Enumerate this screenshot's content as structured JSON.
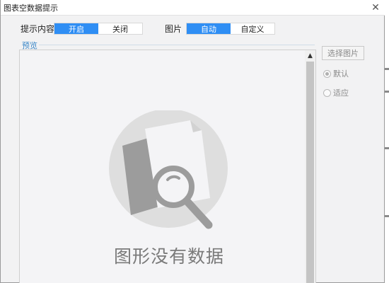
{
  "window": {
    "title": "图表空数据提示",
    "close_glyph": "✕"
  },
  "content_setting": {
    "label": "提示内容",
    "options": [
      "开启",
      "关闭"
    ],
    "selected": "开启"
  },
  "image_setting": {
    "label": "图片",
    "options": [
      "自动",
      "自定义"
    ],
    "selected": "自动"
  },
  "preview": {
    "label": "预览",
    "empty_message": "图形没有数据",
    "empty_icon": "document-magnifier-icon"
  },
  "side": {
    "select_image_button": "选择图片",
    "radio_default": "默认",
    "radio_fit": "适应",
    "selected_radio": "默认"
  },
  "colors": {
    "accent": "#2f8ef4",
    "preview_label": "#3a87c8",
    "illustration_circle": "#dedede",
    "illustration_dark": "#9c9c9c"
  }
}
